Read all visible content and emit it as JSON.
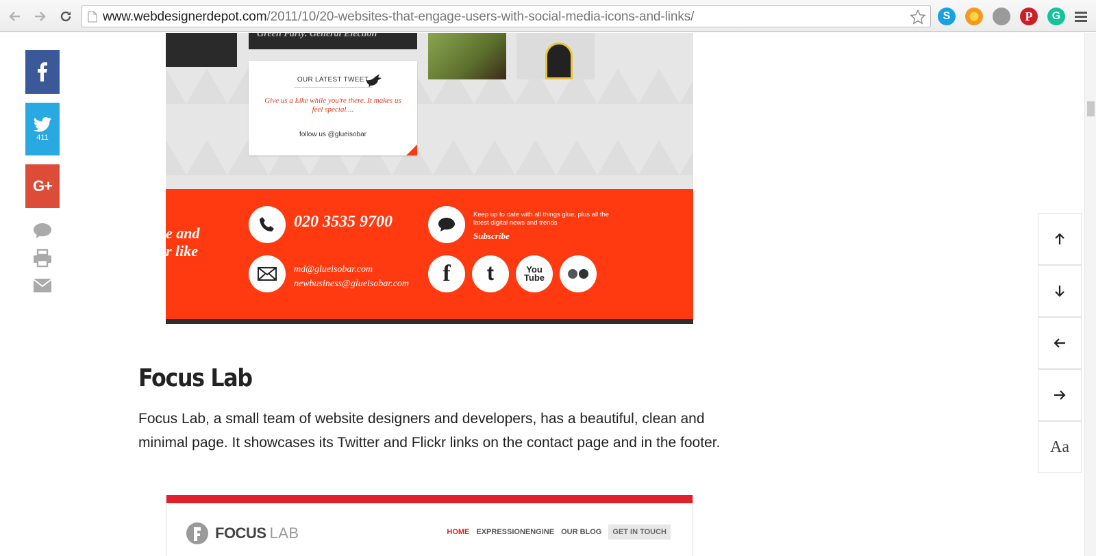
{
  "browser": {
    "url_domain": "www.webdesignerdepot.com",
    "url_path": "/2011/10/20-websites-that-engage-users-with-social-media-icons-and-links/",
    "extensions": [
      {
        "name": "skype-icon",
        "color": "#1aa1e1",
        "glyph": "S"
      },
      {
        "name": "extension-orange-icon",
        "color": "#f39a1e",
        "glyph": ""
      },
      {
        "name": "extension-grey-icon",
        "color": "#9a9a9a",
        "glyph": ""
      },
      {
        "name": "pinterest-icon",
        "color": "#cb2027",
        "glyph": "P"
      },
      {
        "name": "grammarly-icon",
        "color": "#15c39a",
        "glyph": "G"
      }
    ]
  },
  "share": {
    "twitter_count": "411"
  },
  "glue_screenshot": {
    "tweet_heading": "OUR LATEST TWEET",
    "tweet_text": "Give us a Like while you're there. It makes us feel special....",
    "follow": "follow us @glueisobar",
    "phone": "020 3535 9700",
    "email_1": "md@glueisobar.com",
    "email_2": "newbusiness@glueisobar.com",
    "keep_up": "Keep up to date with all things glue, plus all the latest digital news and trends",
    "subscribe": "Subscribe",
    "slogan_1": "e and",
    "slogan_2": "r like",
    "cutoff_text": "Green Party. General Election"
  },
  "article": {
    "title": "Focus Lab",
    "body": "Focus Lab, a small team of website designers and developers, has a beautiful, clean and minimal page. It showcases its Twitter and Flickr links on the contact page and in the footer."
  },
  "focuslab_screenshot": {
    "logo_bold": "FOCUS",
    "logo_light": "LAB",
    "nav": [
      "HOME",
      "EXPRESSIONENGINE",
      "OUR BLOG",
      "GET IN TOUCH"
    ]
  },
  "right_nav": {
    "font_label": "Aa"
  },
  "colors": {
    "facebook": "#3b5998",
    "twitter": "#29a9e1",
    "google_plus": "#dd4b39",
    "glue_red": "#ff3a10",
    "focuslab_red": "#e0212b"
  }
}
